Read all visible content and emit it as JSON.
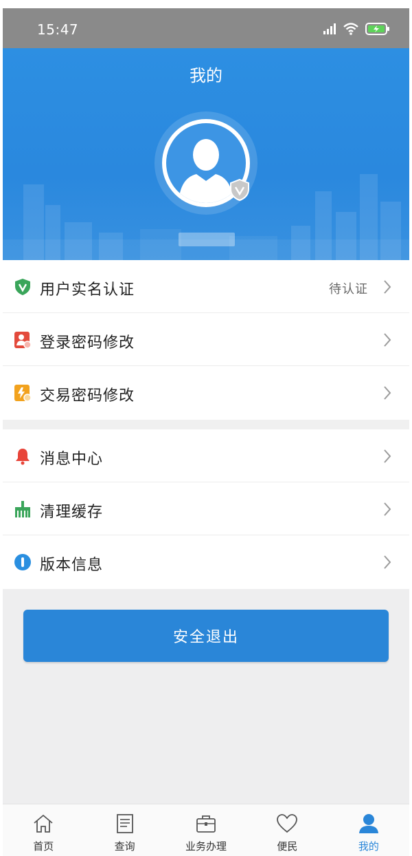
{
  "status_bar": {
    "time": "15:47"
  },
  "header": {
    "title": "我的"
  },
  "menu": {
    "group1": [
      {
        "label": "用户实名认证",
        "value": "待认证",
        "icon": "shield-v-icon",
        "color": "#3aa55a"
      },
      {
        "label": "登录密码修改",
        "icon": "login-password-icon",
        "color": "#e34a3c"
      },
      {
        "label": "交易密码修改",
        "icon": "trade-password-icon",
        "color": "#f2a21e"
      }
    ],
    "group2": [
      {
        "label": "消息中心",
        "icon": "bell-icon",
        "color": "#e8453a"
      },
      {
        "label": "清理缓存",
        "icon": "broom-icon",
        "color": "#3aa55a"
      },
      {
        "label": "版本信息",
        "icon": "info-icon",
        "color": "#2a8fe0"
      }
    ]
  },
  "logout": {
    "label": "安全退出"
  },
  "tabs": [
    {
      "label": "首页",
      "icon": "home-icon"
    },
    {
      "label": "查询",
      "icon": "document-icon"
    },
    {
      "label": "业务办理",
      "icon": "briefcase-icon"
    },
    {
      "label": "便民",
      "icon": "heart-icon"
    },
    {
      "label": "我的",
      "icon": "user-icon",
      "active": true
    }
  ],
  "colors": {
    "primary": "#2a86d8",
    "header": "#2d8fe2",
    "status_bar": "#8a8a8a"
  }
}
